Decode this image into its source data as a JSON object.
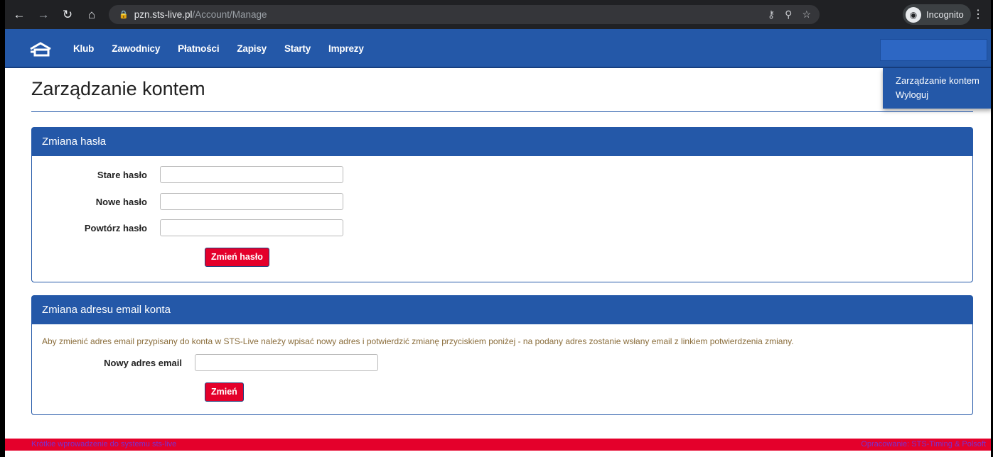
{
  "browser": {
    "url_host": "pzn.sts-live.pl",
    "url_path": "/Account/Manage",
    "profile_label": "Incognito",
    "icons": [
      "back-icon",
      "forward-icon",
      "reload-icon",
      "home-icon",
      "lock-icon",
      "key-icon",
      "zoom-icon",
      "star-icon",
      "incognito-icon",
      "menu-kebab-icon"
    ]
  },
  "navbar": {
    "brand_icon": "sts-logo-icon",
    "links": [
      {
        "label": "Klub"
      },
      {
        "label": "Zawodnicy"
      },
      {
        "label": "Płatności"
      },
      {
        "label": "Zapisy"
      },
      {
        "label": "Starty"
      },
      {
        "label": "Imprezy"
      }
    ],
    "user_menu": {
      "items": [
        {
          "label": "Zarządzanie kontem"
        },
        {
          "label": "Wyloguj"
        }
      ]
    }
  },
  "page": {
    "title": "Zarządzanie kontem"
  },
  "password_panel": {
    "heading": "Zmiana hasła",
    "old_label": "Stare hasło",
    "old_value": "",
    "new_label": "Nowe hasło",
    "new_value": "",
    "repeat_label": "Powtórz hasło",
    "repeat_value": "",
    "submit_label": "Zmień hasło"
  },
  "email_panel": {
    "heading": "Zmiana adresu email konta",
    "info": "Aby zmienić adres email przypisany do konta w STS-Live należy wpisać nowy adres i potwierdzić zmianę przyciskiem poniżej - na podany adres zostanie wsłany email z linkiem potwierdzenia zmiany.",
    "email_label": "Nowy adres email",
    "email_value": "",
    "submit_label": "Zmień"
  },
  "footer": {
    "left_link": "Krótkie wprowadzenie do systemu sts-live",
    "right_text": "Opracowanie: STS-Timing & Polsoft"
  },
  "colors": {
    "primary": "#2458a8",
    "danger": "#e4002b",
    "warning_text": "#8a6d3b"
  }
}
